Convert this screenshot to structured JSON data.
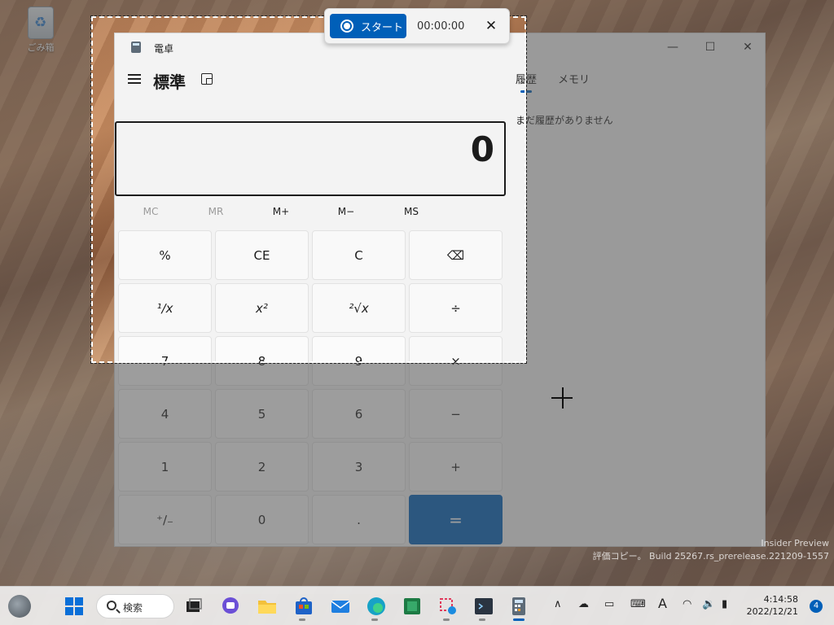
{
  "desktop": {
    "recycle_bin_label": "ごみ箱",
    "watermark_line1": "Insider Preview",
    "watermark_line2": "評価コピー。 Build 25267.rs_prerelease.221209-1557"
  },
  "calculator": {
    "window_title": "電卓",
    "mode_title": "標準",
    "display_value": "0",
    "window_controls": {
      "minimize": "—",
      "maximize": "☐",
      "close": "✕"
    },
    "memory_buttons": [
      "MC",
      "MR",
      "M+",
      "M−",
      "MS"
    ],
    "keys": [
      [
        "%",
        "CE",
        "C",
        "⌫"
      ],
      [
        "¹∕x",
        "x²",
        "²√x",
        "÷"
      ],
      [
        "7",
        "8",
        "9",
        "×"
      ],
      [
        "4",
        "5",
        "6",
        "−"
      ],
      [
        "1",
        "2",
        "3",
        "+"
      ],
      [
        "⁺∕₋",
        "0",
        ".",
        "="
      ]
    ],
    "history_tabs": [
      "履歴",
      "メモリ"
    ],
    "history_empty": "まだ履歴がありません"
  },
  "recorder": {
    "start_label": "スタート",
    "timer": "00:00:00",
    "close_glyph": "✕"
  },
  "taskbar": {
    "search_label": "検索",
    "time": "4:14:58",
    "date": "2022/12/21",
    "notification_count": "4",
    "apps": [
      "start-icon",
      "search",
      "task-view-icon",
      "chat-icon",
      "file-explorer-icon",
      "store-icon",
      "mail-icon",
      "edge-icon",
      "excel-icon",
      "snipping-tool-icon",
      "terminal-icon",
      "calculator-icon"
    ],
    "tray": [
      "chevron-up-icon",
      "onedrive-icon",
      "screen-icon",
      "keyboard-icon",
      "ime-icon",
      "wifi-icon",
      "volume-icon",
      "battery-icon"
    ],
    "ime_label": "A"
  },
  "colors": {
    "accent": "#005fb8",
    "window_bg": "#f3f3f3"
  }
}
